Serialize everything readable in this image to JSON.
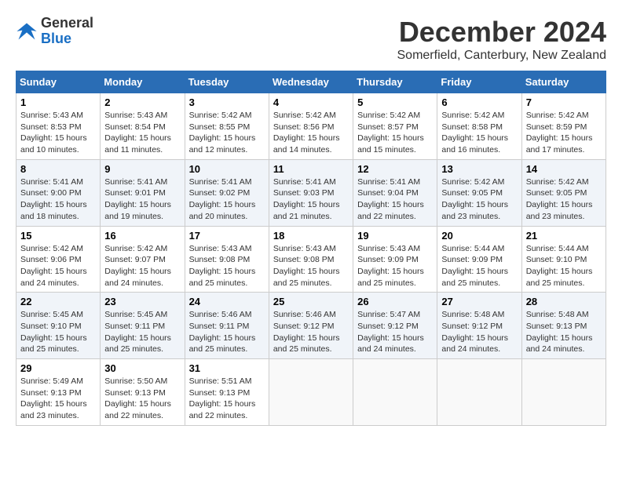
{
  "header": {
    "logo": {
      "line1": "General",
      "line2": "Blue"
    },
    "title": "December 2024",
    "location": "Somerfield, Canterbury, New Zealand"
  },
  "calendar": {
    "weekdays": [
      "Sunday",
      "Monday",
      "Tuesday",
      "Wednesday",
      "Thursday",
      "Friday",
      "Saturday"
    ],
    "weeks": [
      [
        {
          "day": "1",
          "info": "Sunrise: 5:43 AM\nSunset: 8:53 PM\nDaylight: 15 hours\nand 10 minutes."
        },
        {
          "day": "2",
          "info": "Sunrise: 5:43 AM\nSunset: 8:54 PM\nDaylight: 15 hours\nand 11 minutes."
        },
        {
          "day": "3",
          "info": "Sunrise: 5:42 AM\nSunset: 8:55 PM\nDaylight: 15 hours\nand 12 minutes."
        },
        {
          "day": "4",
          "info": "Sunrise: 5:42 AM\nSunset: 8:56 PM\nDaylight: 15 hours\nand 14 minutes."
        },
        {
          "day": "5",
          "info": "Sunrise: 5:42 AM\nSunset: 8:57 PM\nDaylight: 15 hours\nand 15 minutes."
        },
        {
          "day": "6",
          "info": "Sunrise: 5:42 AM\nSunset: 8:58 PM\nDaylight: 15 hours\nand 16 minutes."
        },
        {
          "day": "7",
          "info": "Sunrise: 5:42 AM\nSunset: 8:59 PM\nDaylight: 15 hours\nand 17 minutes."
        }
      ],
      [
        {
          "day": "8",
          "info": "Sunrise: 5:41 AM\nSunset: 9:00 PM\nDaylight: 15 hours\nand 18 minutes."
        },
        {
          "day": "9",
          "info": "Sunrise: 5:41 AM\nSunset: 9:01 PM\nDaylight: 15 hours\nand 19 minutes."
        },
        {
          "day": "10",
          "info": "Sunrise: 5:41 AM\nSunset: 9:02 PM\nDaylight: 15 hours\nand 20 minutes."
        },
        {
          "day": "11",
          "info": "Sunrise: 5:41 AM\nSunset: 9:03 PM\nDaylight: 15 hours\nand 21 minutes."
        },
        {
          "day": "12",
          "info": "Sunrise: 5:41 AM\nSunset: 9:04 PM\nDaylight: 15 hours\nand 22 minutes."
        },
        {
          "day": "13",
          "info": "Sunrise: 5:42 AM\nSunset: 9:05 PM\nDaylight: 15 hours\nand 23 minutes."
        },
        {
          "day": "14",
          "info": "Sunrise: 5:42 AM\nSunset: 9:05 PM\nDaylight: 15 hours\nand 23 minutes."
        }
      ],
      [
        {
          "day": "15",
          "info": "Sunrise: 5:42 AM\nSunset: 9:06 PM\nDaylight: 15 hours\nand 24 minutes."
        },
        {
          "day": "16",
          "info": "Sunrise: 5:42 AM\nSunset: 9:07 PM\nDaylight: 15 hours\nand 24 minutes."
        },
        {
          "day": "17",
          "info": "Sunrise: 5:43 AM\nSunset: 9:08 PM\nDaylight: 15 hours\nand 25 minutes."
        },
        {
          "day": "18",
          "info": "Sunrise: 5:43 AM\nSunset: 9:08 PM\nDaylight: 15 hours\nand 25 minutes."
        },
        {
          "day": "19",
          "info": "Sunrise: 5:43 AM\nSunset: 9:09 PM\nDaylight: 15 hours\nand 25 minutes."
        },
        {
          "day": "20",
          "info": "Sunrise: 5:44 AM\nSunset: 9:09 PM\nDaylight: 15 hours\nand 25 minutes."
        },
        {
          "day": "21",
          "info": "Sunrise: 5:44 AM\nSunset: 9:10 PM\nDaylight: 15 hours\nand 25 minutes."
        }
      ],
      [
        {
          "day": "22",
          "info": "Sunrise: 5:45 AM\nSunset: 9:10 PM\nDaylight: 15 hours\nand 25 minutes."
        },
        {
          "day": "23",
          "info": "Sunrise: 5:45 AM\nSunset: 9:11 PM\nDaylight: 15 hours\nand 25 minutes."
        },
        {
          "day": "24",
          "info": "Sunrise: 5:46 AM\nSunset: 9:11 PM\nDaylight: 15 hours\nand 25 minutes."
        },
        {
          "day": "25",
          "info": "Sunrise: 5:46 AM\nSunset: 9:12 PM\nDaylight: 15 hours\nand 25 minutes."
        },
        {
          "day": "26",
          "info": "Sunrise: 5:47 AM\nSunset: 9:12 PM\nDaylight: 15 hours\nand 24 minutes."
        },
        {
          "day": "27",
          "info": "Sunrise: 5:48 AM\nSunset: 9:12 PM\nDaylight: 15 hours\nand 24 minutes."
        },
        {
          "day": "28",
          "info": "Sunrise: 5:48 AM\nSunset: 9:13 PM\nDaylight: 15 hours\nand 24 minutes."
        }
      ],
      [
        {
          "day": "29",
          "info": "Sunrise: 5:49 AM\nSunset: 9:13 PM\nDaylight: 15 hours\nand 23 minutes."
        },
        {
          "day": "30",
          "info": "Sunrise: 5:50 AM\nSunset: 9:13 PM\nDaylight: 15 hours\nand 22 minutes."
        },
        {
          "day": "31",
          "info": "Sunrise: 5:51 AM\nSunset: 9:13 PM\nDaylight: 15 hours\nand 22 minutes."
        },
        null,
        null,
        null,
        null
      ]
    ]
  }
}
